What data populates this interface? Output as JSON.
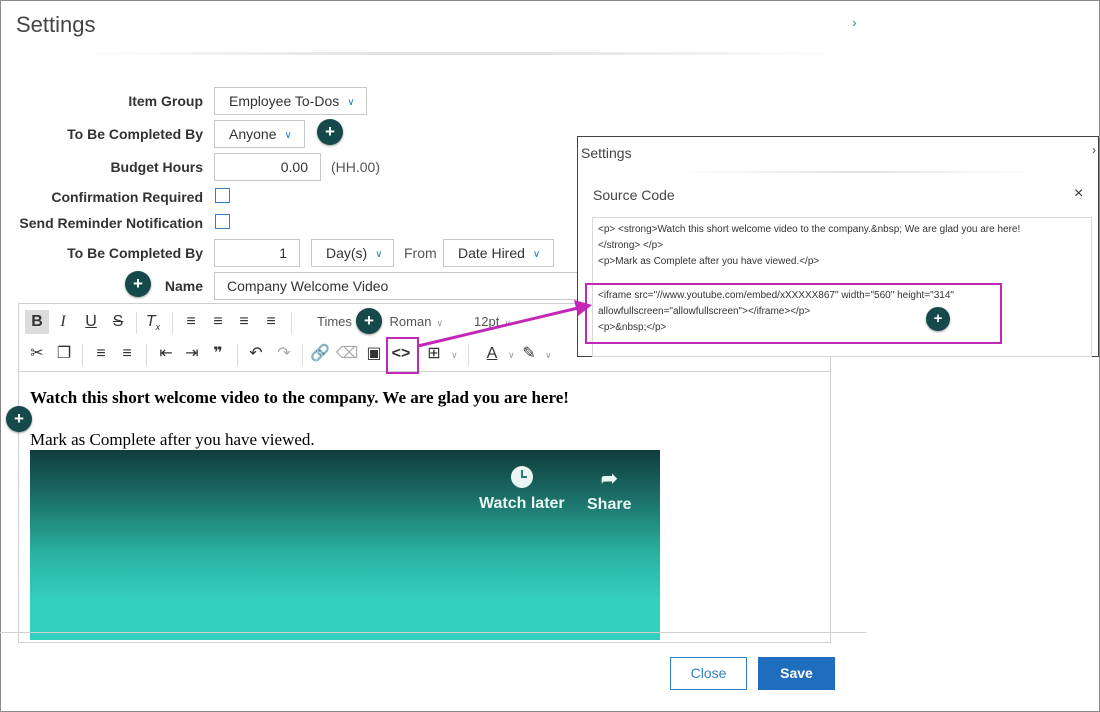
{
  "dialog": {
    "title": "Settings",
    "close_glyph": "›"
  },
  "form": {
    "item_group_label": "Item Group",
    "item_group_value": "Employee To-Dos",
    "completed_by_label": "To Be Completed By",
    "completed_by_value": "Anyone",
    "budget_label": "Budget Hours",
    "budget_value": "0.00",
    "budget_hint": "(HH.00)",
    "confirmation_label": "Confirmation Required",
    "reminder_label": "Send Reminder Notification",
    "completed_by2_label": "To Be Completed By",
    "completed_by2_number": "1",
    "period_value": "Day(s)",
    "from_label": "From",
    "from_value": "Date Hired",
    "name_label": "Name",
    "name_value": "Company Welcome Video"
  },
  "toolbar": {
    "font_family": "Times",
    "font_family_tail": "Roman",
    "font_size": "12pt"
  },
  "content": {
    "bold_line": "Watch this short welcome video to the company.  We are glad you are here!",
    "line2": "Mark as Complete after you have viewed.",
    "video": {
      "watch_later": "Watch later",
      "share": "Share"
    }
  },
  "footer": {
    "close_label": "Close",
    "save_label": "Save"
  },
  "popup": {
    "title": "Settings",
    "source_title": "Source Code",
    "close_glyph": "×",
    "code_lines": [
      "<p> <strong>Watch this short welcome video to the company.&nbsp; We are glad you are here!",
      "</strong> </p>",
      "<p>Mark as Complete after you have viewed.</p>",
      "<iframe src=\"//www.youtube.com/embed/xXXXXX867\" width=\"560\" height=\"314\"",
      "allowfullscreen=\"allowfullscreen\"></iframe></p>",
      "<p>&nbsp;</p>"
    ]
  },
  "colors": {
    "plus_badge": "#15494a",
    "highlight": "#c327b5",
    "primary": "#1f6dbd"
  }
}
